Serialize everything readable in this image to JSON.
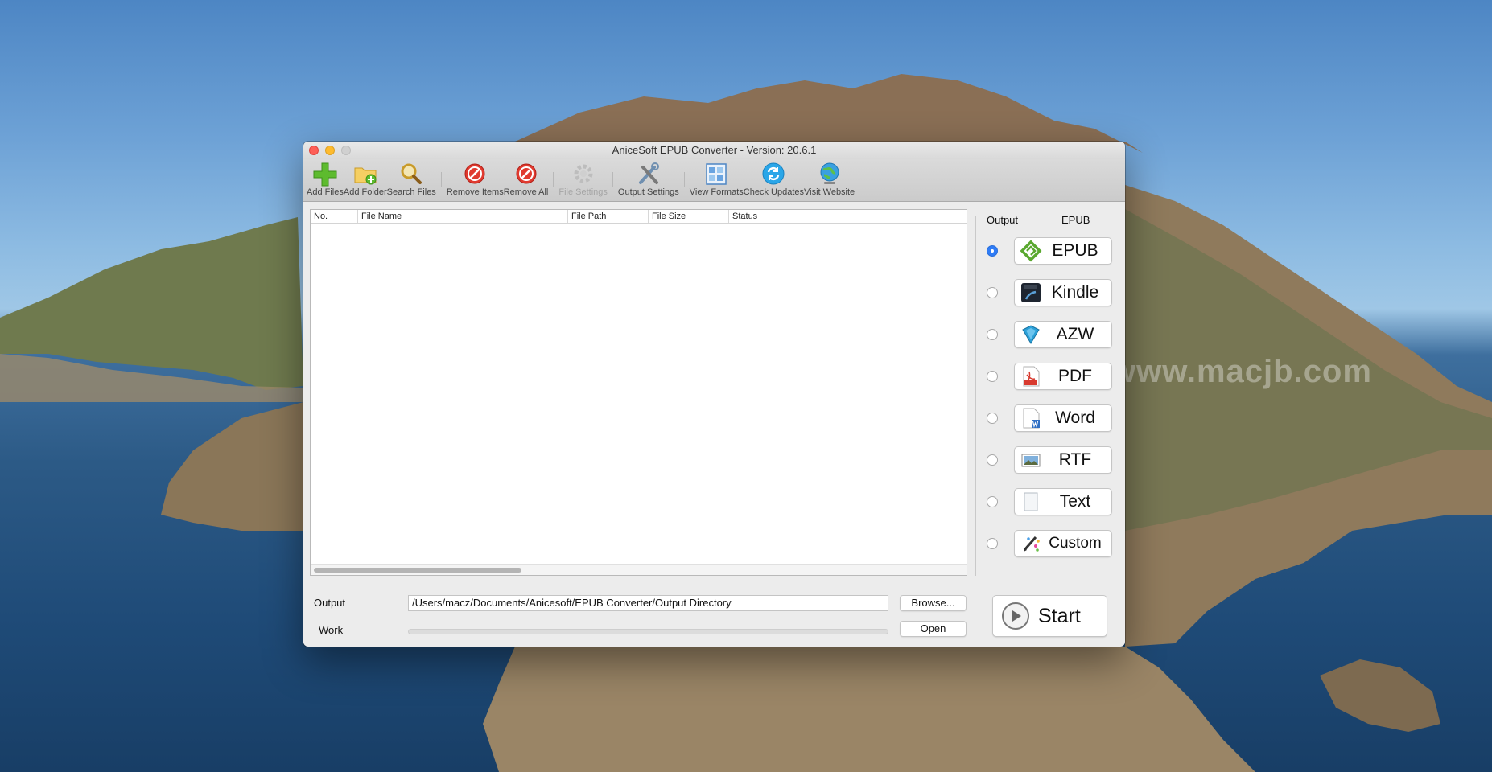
{
  "window": {
    "title": "AniceSoft EPUB Converter - Version: 20.6.1"
  },
  "toolbar": {
    "add_files": "Add Files",
    "add_folder": "Add Folder",
    "search_files": "Search Files",
    "remove_items": "Remove Items",
    "remove_all": "Remove All",
    "file_settings": "File Settings",
    "output_settings": "Output Settings",
    "view_formats": "View Formats",
    "check_updates": "Check Updates",
    "visit_website": "Visit Website"
  },
  "table": {
    "columns": [
      "No.",
      "File Name",
      "File Path",
      "File Size",
      "Status"
    ],
    "rows": []
  },
  "side": {
    "output_label": "Output",
    "current_format": "EPUB",
    "formats": [
      {
        "label": "EPUB",
        "selected": true,
        "icon": "epub-icon"
      },
      {
        "label": "Kindle",
        "selected": false,
        "icon": "kindle-icon"
      },
      {
        "label": "AZW",
        "selected": false,
        "icon": "azw-book-icon"
      },
      {
        "label": "PDF",
        "selected": false,
        "icon": "pdf-icon"
      },
      {
        "label": "Word",
        "selected": false,
        "icon": "word-document-icon"
      },
      {
        "label": "RTF",
        "selected": false,
        "icon": "rtf-image-icon"
      },
      {
        "label": "Text",
        "selected": false,
        "icon": "text-file-icon"
      },
      {
        "label": "Custom",
        "selected": false,
        "icon": "custom-pen-icon"
      }
    ]
  },
  "bottom": {
    "output_label": "Output",
    "output_path": "/Users/macz/Documents/Anicesoft/EPUB Converter/Output Directory",
    "work_label": "Work",
    "browse_label": "Browse...",
    "open_label": "Open",
    "start_label": "Start",
    "progress": 0
  },
  "desktop": {
    "watermark": "www.macjb.com"
  },
  "colors": {
    "accent": "#2f7cf6",
    "close": "#fe5f57",
    "minimize": "#febb2e"
  }
}
